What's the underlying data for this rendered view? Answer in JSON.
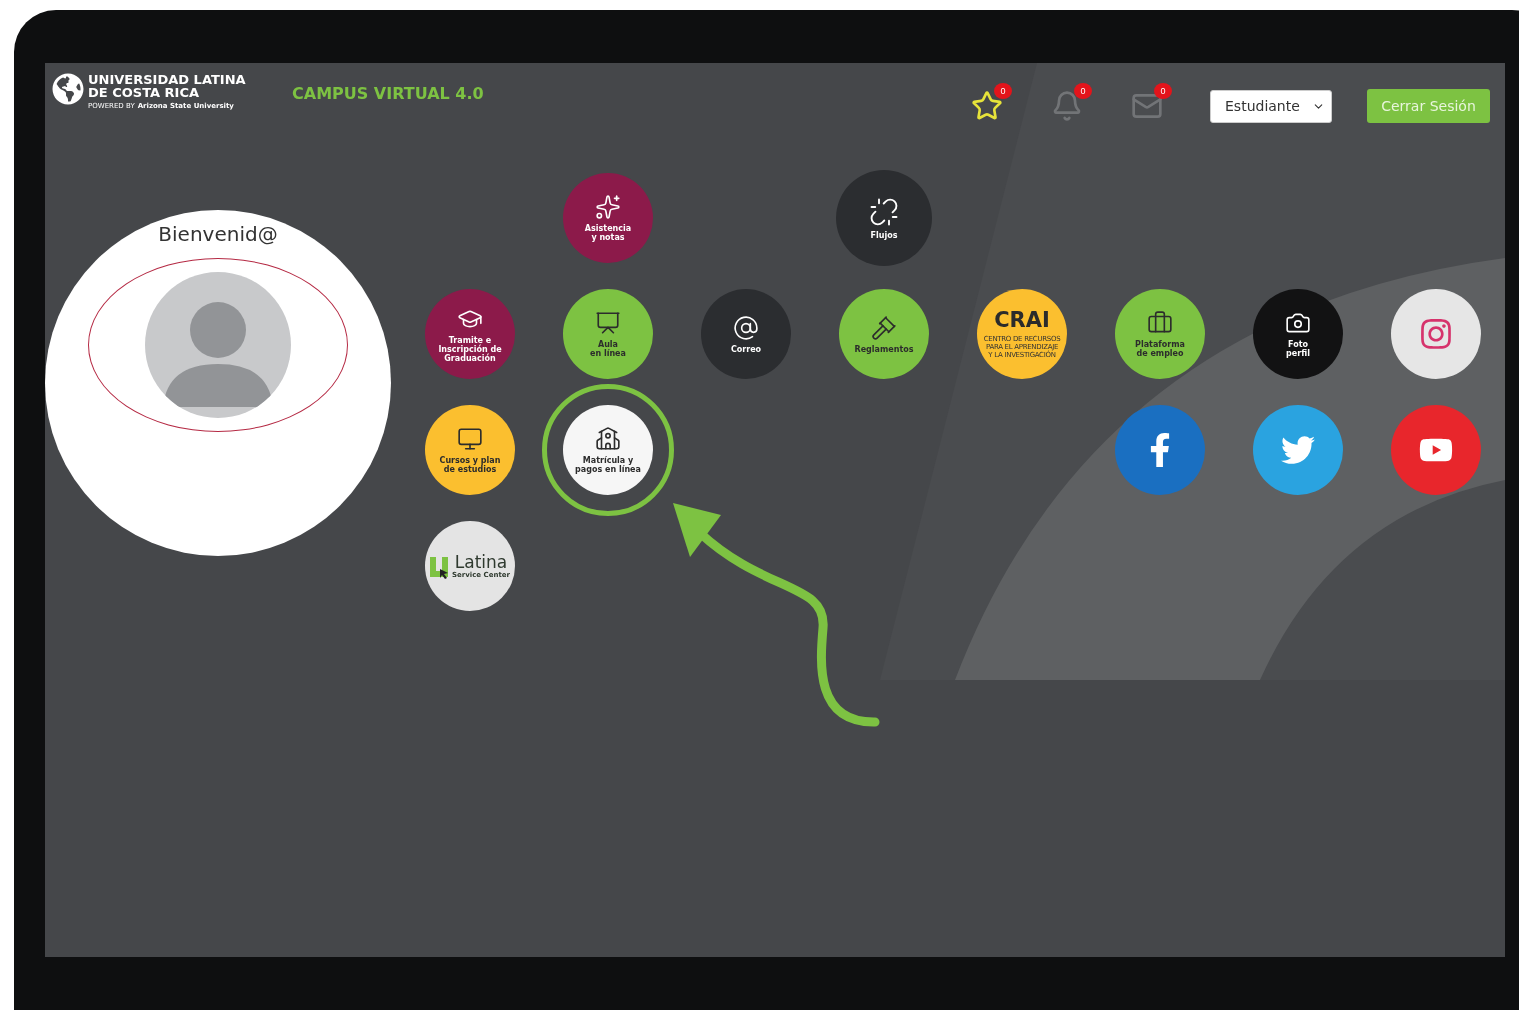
{
  "header": {
    "logo": {
      "line_1": "UNIVERSIDAD LATINA",
      "line_2": "DE COSTA RICA",
      "tagline_prefix": "POWERED BY",
      "tagline": "Arizona State University"
    },
    "title": "CAMPUS VIRTUAL 4.0",
    "notifications": [
      {
        "count": "0"
      },
      {
        "count": "0"
      },
      {
        "count": "0"
      }
    ],
    "role_select": {
      "value": "Estudiante"
    },
    "logout_button": "Cerrar Sesión"
  },
  "profile": {
    "greeting": "Bienvenid@"
  },
  "tiles": [
    {
      "kind": "service",
      "label": "Asistencia\ny notas",
      "color": "#8c1a4a",
      "highlighted": false
    },
    {
      "kind": "service",
      "label": "Flujos",
      "color": "#2b2d30",
      "highlighted": false
    },
    {
      "kind": "service",
      "label": "Tramite e\nInscripción de\nGraduación",
      "color": "#8c1a4a",
      "highlighted": false
    },
    {
      "kind": "service",
      "label": "Aula\nen línea",
      "color": "#7dc242",
      "highlighted": false
    },
    {
      "kind": "service",
      "label": "Correo",
      "color": "#2b2d30",
      "highlighted": false
    },
    {
      "kind": "service",
      "label": "Reglamentos",
      "color": "#7dc242",
      "highlighted": false
    },
    {
      "kind": "logo",
      "label": "CRAI",
      "sublabel": "CENTRO DE RECURSOS\nPARA EL APRENDIZAJE\nY LA INVESTIGACIÓN",
      "color": "#fbbf2f",
      "highlighted": false
    },
    {
      "kind": "service",
      "label": "Plataforma\nde empleo",
      "color": "#7dc242",
      "highlighted": false
    },
    {
      "kind": "service",
      "label": "Foto\nperfil",
      "color": "#121213",
      "highlighted": false
    },
    {
      "kind": "social",
      "color": "#e6e6e6",
      "highlighted": false
    },
    {
      "kind": "service",
      "label": "Cursos y plan\nde estudios",
      "color": "#fbbf2f",
      "highlighted": false
    },
    {
      "kind": "service",
      "label": "Matrícula y\npagos en línea",
      "color": "#f6f6f6",
      "highlighted": true
    },
    {
      "kind": "social",
      "color": "#1a6fc1",
      "highlighted": false
    },
    {
      "kind": "social",
      "color": "#2aa3e0",
      "highlighted": false
    },
    {
      "kind": "social",
      "color": "#e8262c",
      "highlighted": false
    },
    {
      "kind": "badge_logo",
      "label": "Latina",
      "sublabel": "Service Center",
      "color": "#e4e4e4",
      "highlighted": false
    }
  ]
}
